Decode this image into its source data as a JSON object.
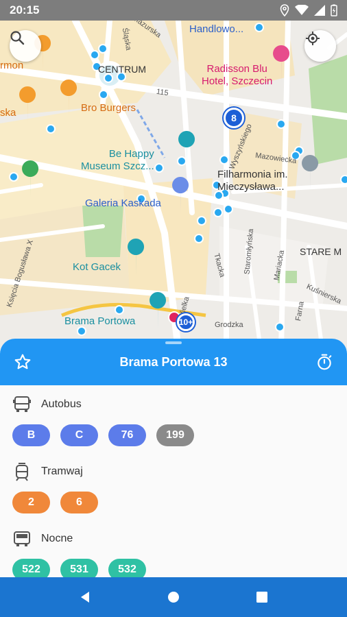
{
  "status": {
    "time": "20:15"
  },
  "map": {
    "labels": {
      "centrum_handlowe": "Centrum\nHandlowo...",
      "centrum": "CENTRUM",
      "radisson": "Radisson Blu\nHotel, Szczecin",
      "bro_burgers": "Bro Burgers",
      "be_happy": "Be Happy\nMuseum Szcz...",
      "filharmonia": "Filharmonia im.\nMieczysława...",
      "galeria": "Galeria Kaskada",
      "kot_gacek": "Kot Gacek",
      "brama_portowa": "Brama Portowa",
      "stare_miasto": "STARE M",
      "ska": "ska",
      "rmon": "rmon",
      "grodzka": "Grodzka",
      "mazowiecka": "Mazowiecka",
      "road_115": "115",
      "mazurska": "Mazurska",
      "slaska": "Śląska",
      "tkacka": "Tkacka",
      "staromlynska": "Staromłyńska",
      "mariacka": "Mariacka",
      "farna": "Farna",
      "kusnierska": "Kuśnierska",
      "boguslawa": "Księcia Bogusława X",
      "wyszynskiego": "Wyszyńskiego",
      "wielka": "Wielka"
    },
    "cluster_main": "8",
    "cluster_small": "10+"
  },
  "sheet": {
    "stop_name": "Brama Portowa 13",
    "sections": [
      {
        "title": "Autobus",
        "lines": [
          {
            "label": "B",
            "color": "#5c7cea"
          },
          {
            "label": "C",
            "color": "#5c7cea"
          },
          {
            "label": "76",
            "color": "#5c7cea"
          },
          {
            "label": "199",
            "color": "#8a8a8a"
          }
        ]
      },
      {
        "title": "Tramwaj",
        "lines": [
          {
            "label": "2",
            "color": "#f0883a"
          },
          {
            "label": "6",
            "color": "#f0883a"
          }
        ]
      },
      {
        "title": "Nocne",
        "lines": [
          {
            "label": "522",
            "color": "#2fc1a4"
          },
          {
            "label": "531",
            "color": "#2fc1a4"
          },
          {
            "label": "532",
            "color": "#2fc1a4"
          }
        ]
      }
    ]
  },
  "icons": {
    "search": "search-icon",
    "location": "my-location-icon",
    "favorite": "star-outline-icon",
    "timer": "timer-icon",
    "bus": "bus-icon",
    "tram": "tram-icon",
    "night_bus": "night-bus-icon",
    "back": "back-triangle-icon",
    "home": "home-circle-icon",
    "recents": "recents-square-icon"
  },
  "colors": {
    "header": "#2196f3",
    "navbar": "#1b75d0",
    "stop_marker": "#29a8f0"
  }
}
